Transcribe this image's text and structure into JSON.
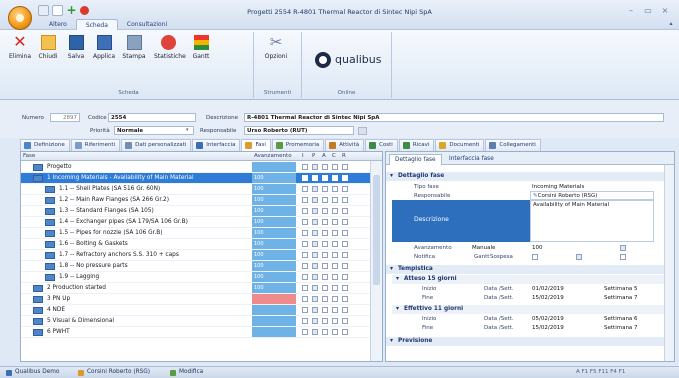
{
  "window": {
    "title": "Progetti 2554 R-4801 Thermal Reactor di Sintec Nipi SpA"
  },
  "ribbon_tabs": [
    "Altero",
    "Scheda",
    "Consultazioni"
  ],
  "ribbon": {
    "groups": {
      "scheda": "Scheda",
      "strumenti": "Strumenti",
      "online": "Online"
    },
    "buttons": {
      "elimina": "Elimina",
      "chiudi": "Chiudi",
      "salva": "Salva",
      "applica": "Applica",
      "stampa": "Stampa",
      "statistiche": "Statistiche",
      "gantt": "Gantt",
      "opzioni": "Opzioni"
    },
    "logo_text": "qualibus"
  },
  "form": {
    "numero_label": "Numero",
    "numero_value": "2897",
    "codice_label": "Codice",
    "codice_value": "2554",
    "descrizione_label": "Descrizione",
    "descrizione_value": "R-4801 Thermal Reactor di Sintec Nipi SpA",
    "priorita_label": "Priorità",
    "priorita_value": "Normale",
    "responsabile_label": "Responsabile",
    "responsabile_value": "Urso Roberto (RUT)"
  },
  "section_tabs": [
    {
      "label": "Definizione",
      "color": "#4a84c9"
    },
    {
      "label": "Riferimenti",
      "color": "#7a9cc7"
    },
    {
      "label": "Dati personalizzati",
      "color": "#6f8fb8"
    },
    {
      "label": "Interfaccia",
      "color": "#3a6fb5"
    },
    {
      "label": "Fasi",
      "color": "#e09a2d"
    },
    {
      "label": "Promemoria",
      "color": "#5a9b3f"
    },
    {
      "label": "Attività",
      "color": "#c47a24"
    },
    {
      "label": "Costi",
      "color": "#3d8b48"
    },
    {
      "label": "Ricavi",
      "color": "#3d8b48"
    },
    {
      "label": "Documenti",
      "color": "#d9a52a"
    },
    {
      "label": "Collegamenti",
      "color": "#5d7db0"
    }
  ],
  "grid": {
    "headers": {
      "fase": "Fase",
      "avanzamento": "Avanzamento",
      "i": "I",
      "p": "P",
      "a": "A",
      "c": "C",
      "r": "R"
    },
    "rows": [
      {
        "name": "Progetto",
        "progress": "",
        "level": 0,
        "selected": false
      },
      {
        "name": "1 Incoming Materials - Availability of Main Material",
        "progress": "100",
        "level": 0,
        "selected": true
      },
      {
        "name": "1.1 -- Shell Plates (SA 516 Gr. 60N)",
        "progress": "100",
        "level": 1,
        "selected": false
      },
      {
        "name": "1.2 -- Main Raw Flanges (SA 266 Gr.2)",
        "progress": "100",
        "level": 1,
        "selected": false
      },
      {
        "name": "1.3 -- Standard Flanges (SA 105)",
        "progress": "100",
        "level": 1,
        "selected": false
      },
      {
        "name": "1.4 -- Exchanger pipes (SA 179/SA 106 Gr.B)",
        "progress": "100",
        "level": 1,
        "selected": false
      },
      {
        "name": "1.5 -- Pipes for nozzle (SA 106 Gr.B)",
        "progress": "100",
        "level": 1,
        "selected": false
      },
      {
        "name": "1.6 -- Bolting & Gaskets",
        "progress": "100",
        "level": 1,
        "selected": false
      },
      {
        "name": "1.7 -- Refractory anchors S.S. 310 + caps",
        "progress": "100",
        "level": 1,
        "selected": false
      },
      {
        "name": "1.8 -- No pressure parts",
        "progress": "100",
        "level": 1,
        "selected": false
      },
      {
        "name": "1.9 -- Lagging",
        "progress": "100",
        "level": 1,
        "selected": false
      },
      {
        "name": "2 Production started",
        "progress": "100",
        "level": 0,
        "selected": false
      },
      {
        "name": "3 PN Up",
        "progress": "",
        "level": 0,
        "selected": false,
        "red": true
      },
      {
        "name": "4 NDE",
        "progress": "",
        "level": 0,
        "selected": false
      },
      {
        "name": "5 Visual & Dimensional",
        "progress": "",
        "level": 0,
        "selected": false
      },
      {
        "name": "6 PWHT",
        "progress": "",
        "level": 0,
        "selected": false
      }
    ]
  },
  "detail": {
    "tabs": [
      "Dettaglio fase",
      "Interfaccia fase"
    ],
    "section_dettaglio": "Dettaglio fase",
    "tipo_fase_label": "Tipo fase",
    "tipo_fase_value": "Incoming Materials",
    "responsabile_label": "Responsabile",
    "responsabile_value": "Corsini Roberto (RSG)",
    "descrizione_label": "Descrizione",
    "descrizione_value": "Availability of Main Material",
    "avanzamento_label": "Avanzamento",
    "avanzamento_mode": "Manuale",
    "avanzamento_value": "100",
    "notifica_label": "Notifica",
    "gantt_label": "Gantt",
    "sospesa_label": "Sospesa",
    "section_tempistica": "Tempistica",
    "atteso_label": "Atteso 15 giorni",
    "effettivo_label": "Effettivo 11 giorni",
    "inizio_label": "Inizio",
    "fine_label": "Fine",
    "data_sett_label": "Data /Sett.",
    "atteso_inizio": "01/02/2019",
    "atteso_inizio_week": "Settimana 5",
    "atteso_fine": "15/02/2019",
    "atteso_fine_week": "Settimana 7",
    "effettivo_inizio": "05/02/2019",
    "effettivo_inizio_week": "Settimana 6",
    "effettivo_fine": "15/02/2019",
    "effettivo_fine_week": "Settimana 7",
    "section_previsione": "Previsione"
  },
  "statusbar": {
    "items": [
      {
        "label": "Qualibus Demo",
        "color": "#3a6fb5"
      },
      {
        "label": "Corsini Roberto (RSG)",
        "color": "#d99a2a"
      },
      {
        "label": "Modifica",
        "color": "#5a9b3f"
      }
    ],
    "fkeys": "A  F1  F5  F11  F4  F1"
  }
}
